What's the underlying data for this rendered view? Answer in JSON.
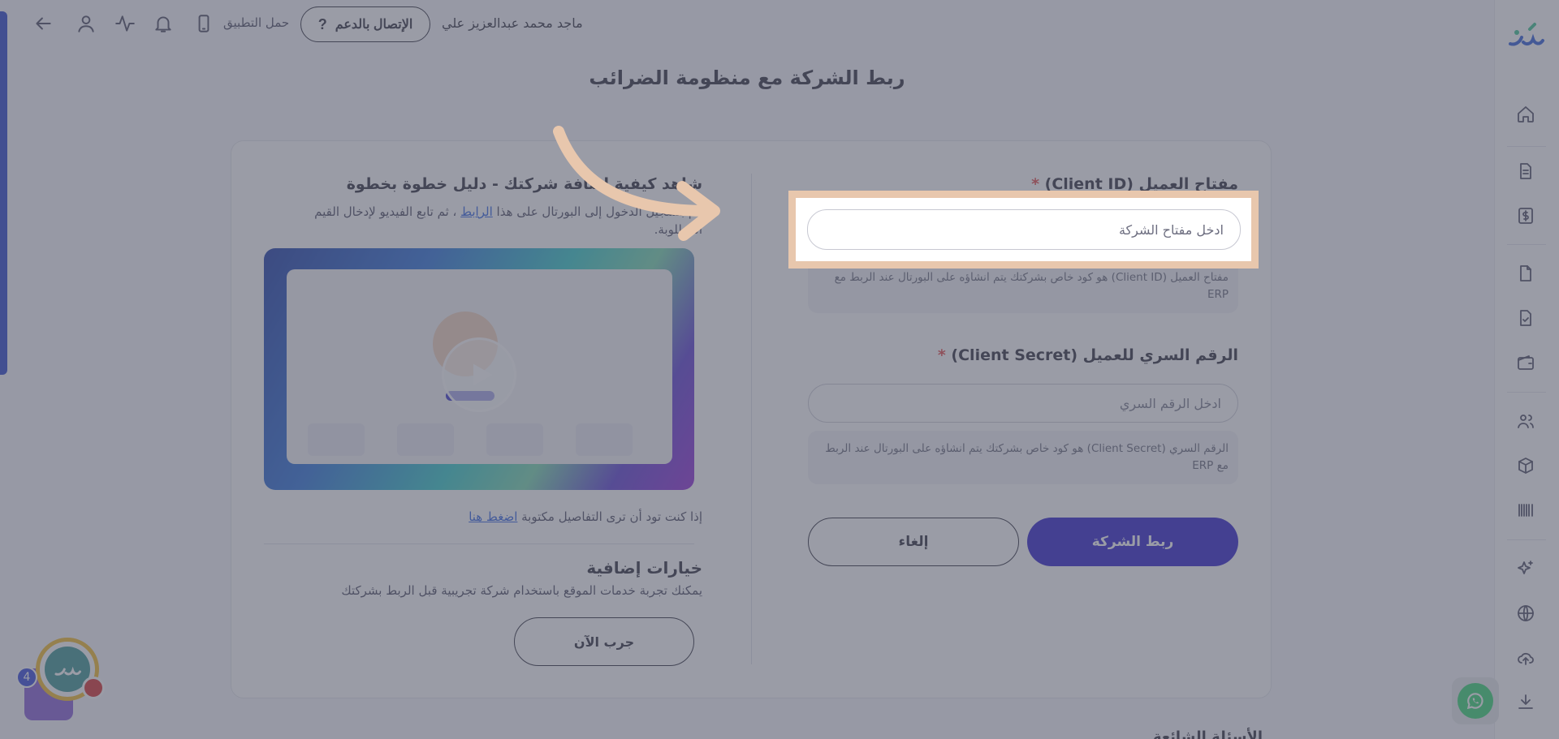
{
  "topbar": {
    "user_name": "ماجد محمد عبدالعزيز علي",
    "support_label": "الإتصال بالدعم",
    "support_icon": "?",
    "app_download": "حمل التطبيق"
  },
  "page_title": "ربط الشركة مع منظومة الضرائب",
  "form": {
    "client_id": {
      "label": "مفتاح العميل (Client ID)",
      "required_mark": "*",
      "placeholder": "ادخل مفتاح الشركة",
      "value": "",
      "hint": "مفتاح العميل (Client ID) هو كود خاص بشركتك يتم انشاؤه على البورتال عند الربط مع ERP"
    },
    "client_secret": {
      "label": "الرقم السري للعميل (Client Secret)",
      "required_mark": "*",
      "placeholder": "ادخل الرقم السري",
      "value": "",
      "hint": "الرقم السري (Client Secret) هو كود خاص بشركتك يتم انشاؤه على البورتال عند الربط مع ERP"
    },
    "submit_label": "ربط الشركة",
    "cancel_label": "إلغاء"
  },
  "guide": {
    "heading": "شاهد كيفية إضافة شركتك - دليل خطوة بخطوة",
    "desc_before": "قم بتسجيل الدخول إلى البورتال على هذا",
    "desc_link": "الرابط",
    "desc_after": "، ثم تابع الفيديو لإدخال القيم المطلوبة.",
    "details_text": "إذا كنت تود أن ترى التفاصيل مكتوبة",
    "details_link": "اضغط هنا"
  },
  "extra": {
    "heading": "خيارات إضافية",
    "desc": "يمكنك تجربة خدمات الموقع باستخدام شركة تجريبية قبل الربط بشركتك",
    "try_label": "جرب الآن"
  },
  "faq_peek": "الأسئلة الشائعة",
  "assistant": {
    "badge_count": "4"
  },
  "colors": {
    "primary": "#1d0fc9",
    "highlight_frame": "#e8c7ad",
    "required": "#e23b3b",
    "overlay": "#5c6070"
  },
  "sidebar_icons": [
    "home-icon",
    "document-icon",
    "dollar-icon",
    "file-icon",
    "file-check-icon",
    "wallet-icon",
    "users-icon",
    "box-icon",
    "barcode-icon",
    "sparkles-icon",
    "globe-icon",
    "cloud-upload-icon",
    "download-icon"
  ]
}
